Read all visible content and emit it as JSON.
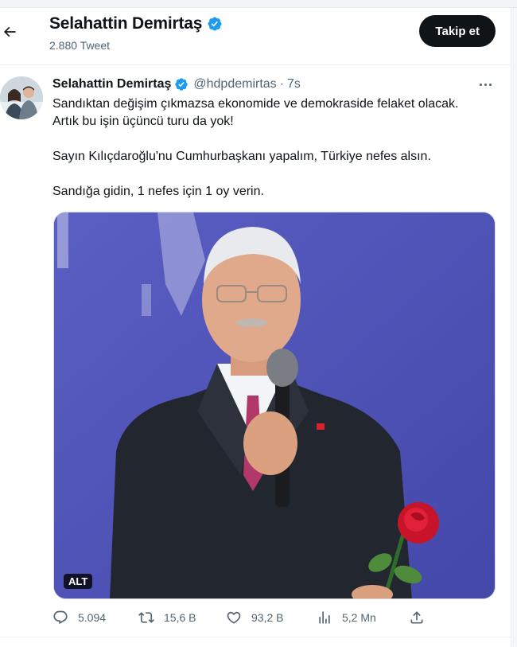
{
  "header": {
    "name": "Selahattin Demirtaş",
    "tweet_count": "2.880 Tweet",
    "follow_label": "Takip et"
  },
  "tweet": {
    "name": "Selahattin Demirtaş",
    "handle": "@hdpdemirtas",
    "separator": "·",
    "time": "7s",
    "text": {
      "line1": "Sandıktan değişim çıkmazsa ekonomide ve demokraside felaket olacak.",
      "line2": "Artık bu işin üçüncü turu da yok!",
      "line3": "Sayın Kılıçdaroğlu'nu Cumhurbaşkanı yapalım, Türkiye nefes alsın.",
      "line4": "Sandığa gidin, 1 nefes için 1 oy verin."
    },
    "media": {
      "alt_label": "ALT"
    },
    "actions": {
      "replies": "5.094",
      "retweets": "15,6 B",
      "likes": "93,2 B",
      "views": "5,2 Mn"
    }
  },
  "colors": {
    "verified": "#1d9bf0",
    "follow_bg": "#0f1419",
    "secondary_text": "#536471",
    "media_bg": "#4d52b8"
  },
  "icons": [
    "back-arrow-icon",
    "verified-badge-icon",
    "more-icon",
    "reply-icon",
    "retweet-icon",
    "like-icon",
    "views-icon",
    "share-icon"
  ]
}
